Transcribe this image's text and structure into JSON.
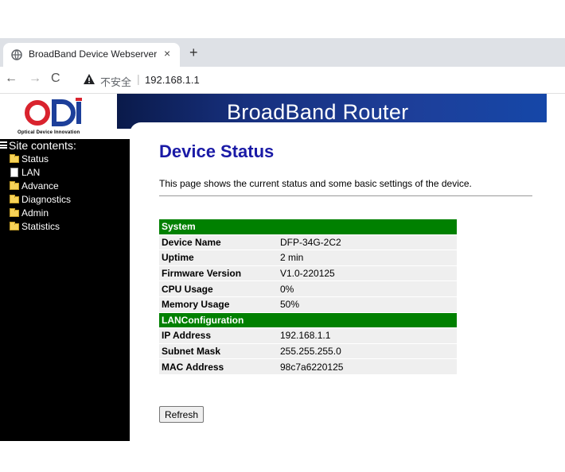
{
  "browser": {
    "tab_title": "BroadBand Device Webserver",
    "tab_close": "×",
    "new_tab": "+",
    "nav_back": "←",
    "nav_forward": "→",
    "nav_reload": "C",
    "security_label": "不安全",
    "url_separator": "|",
    "url": "192.168.1.1"
  },
  "header": {
    "logo_text": "ODI",
    "logo_subtitle": "Optical Device Innovation",
    "banner_title": "BroadBand Router"
  },
  "sidebar": {
    "heading": "Site contents:",
    "items": [
      {
        "label": "Status",
        "icon": "folder-icon"
      },
      {
        "label": "LAN",
        "icon": "document-icon"
      },
      {
        "label": "Advance",
        "icon": "folder-icon"
      },
      {
        "label": "Diagnostics",
        "icon": "folder-icon"
      },
      {
        "label": "Admin",
        "icon": "folder-icon"
      },
      {
        "label": "Statistics",
        "icon": "folder-icon"
      }
    ]
  },
  "main": {
    "title": "Device Status",
    "description": "This page shows the current status and some basic settings of the device.",
    "sections": [
      {
        "heading": "System",
        "rows": [
          {
            "key": "Device Name",
            "value": "DFP-34G-2C2"
          },
          {
            "key": "Uptime",
            "value": "2 min"
          },
          {
            "key": "Firmware Version",
            "value": "V1.0-220125"
          },
          {
            "key": "CPU Usage",
            "value": "0%"
          },
          {
            "key": "Memory Usage",
            "value": "50%"
          }
        ]
      },
      {
        "heading": "LANConfiguration",
        "rows": [
          {
            "key": "IP Address",
            "value": "192.168.1.1"
          },
          {
            "key": "Subnet Mask",
            "value": "255.255.255.0"
          },
          {
            "key": "MAC Address",
            "value": "98c7a6220125"
          }
        ]
      }
    ],
    "refresh_label": "Refresh"
  },
  "colors": {
    "section_header": "#008000",
    "title": "#1a1aa6",
    "banner": "#1d3f9a",
    "logo_red": "#d9232e"
  }
}
